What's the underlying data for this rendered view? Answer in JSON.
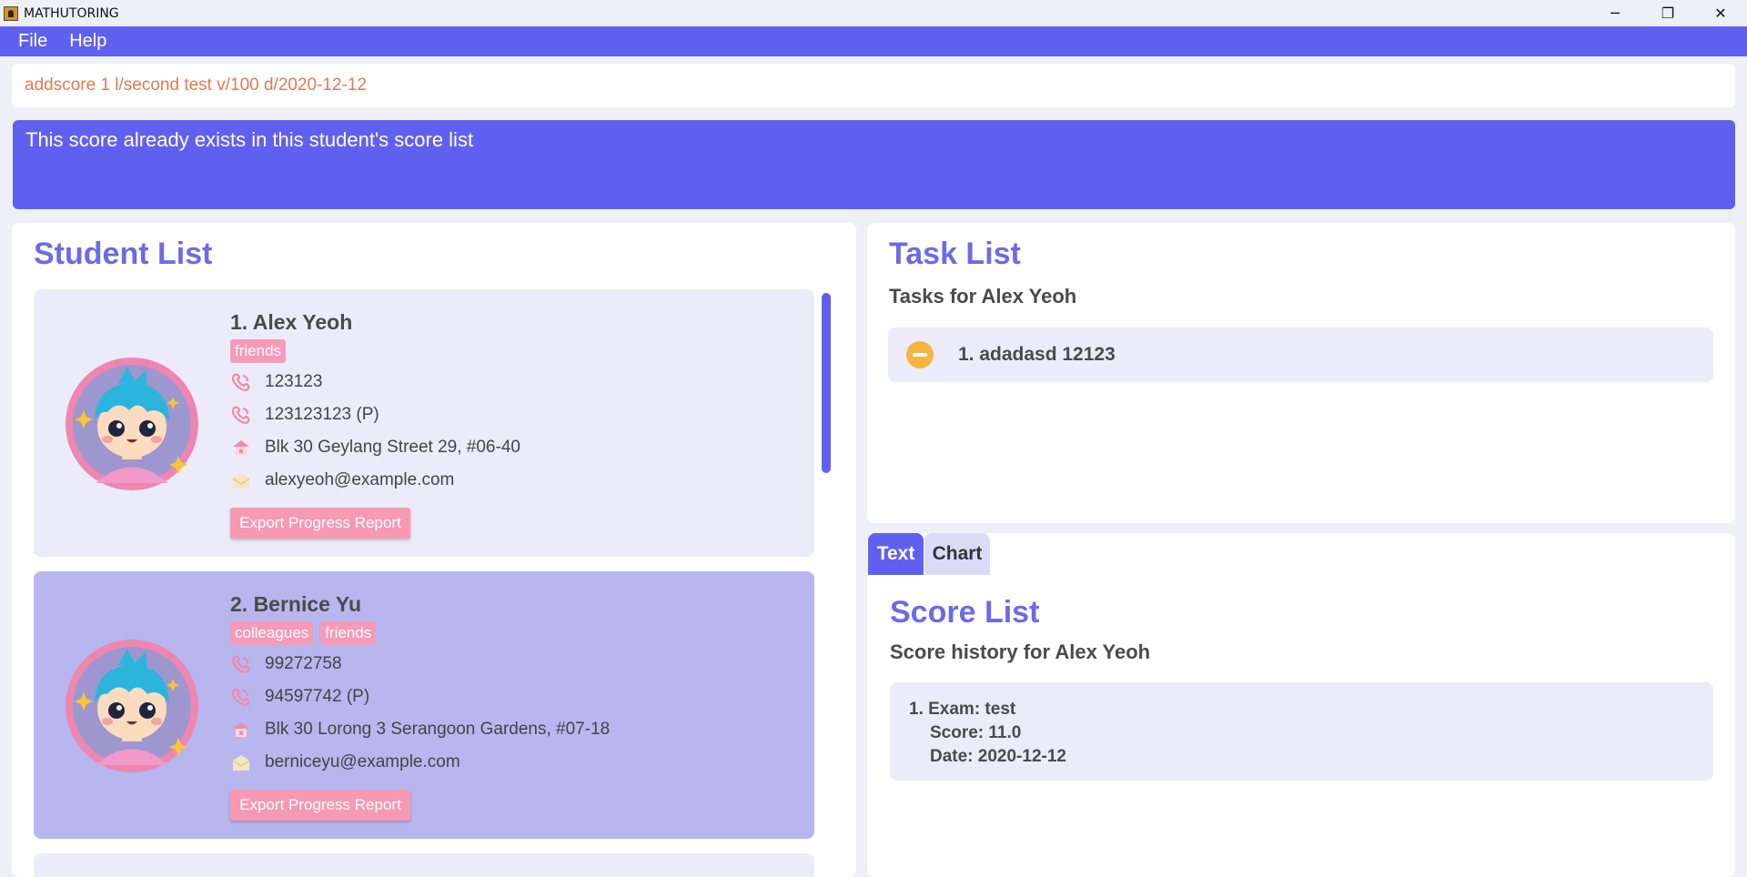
{
  "window": {
    "title": "MATHUTORING",
    "minimize_glyph": "─",
    "maximize_glyph": "❐",
    "close_glyph": "✕"
  },
  "menu": {
    "items": [
      "File",
      "Help"
    ]
  },
  "command": {
    "value": "addscore 1 l/second test v/100 d/2020-12-12"
  },
  "result": {
    "message": "This score already exists in this student's score list"
  },
  "students": {
    "title": "Student List",
    "export_label": "Export Progress Report",
    "items": [
      {
        "name": "1.  Alex Yeoh",
        "tags": [
          "friends"
        ],
        "phone": "123123",
        "parent_phone": "123123123 (P)",
        "address": "Blk 30 Geylang Street 29, #06-40",
        "email": "alexyeoh@example.com"
      },
      {
        "name": "2.  Bernice Yu",
        "tags": [
          "colleagues",
          "friends"
        ],
        "phone": "99272758",
        "parent_phone": "94597742 (P)",
        "address": "Blk 30 Lorong 3 Serangoon Gardens, #07-18",
        "email": "berniceyu@example.com"
      }
    ]
  },
  "tasks": {
    "title": "Task List",
    "subtitle": "Tasks for Alex Yeoh",
    "items": [
      {
        "label": "1. adadasd 12123",
        "status_icon": "in-progress-icon"
      }
    ]
  },
  "scores": {
    "tabs": [
      "Text",
      "Chart"
    ],
    "active_tab": "Text",
    "title": "Score List",
    "subtitle": "Score history for Alex Yeoh",
    "items": [
      {
        "exam": "1. Exam: test",
        "score": "Score: 11.0",
        "date": "Date: 2020-12-12"
      }
    ]
  },
  "colors": {
    "accent": "#6060f0",
    "tag": "#f79ab8",
    "card": "#ecebf9",
    "card_selected": "#b8b6ef",
    "title": "#6b6be8"
  }
}
